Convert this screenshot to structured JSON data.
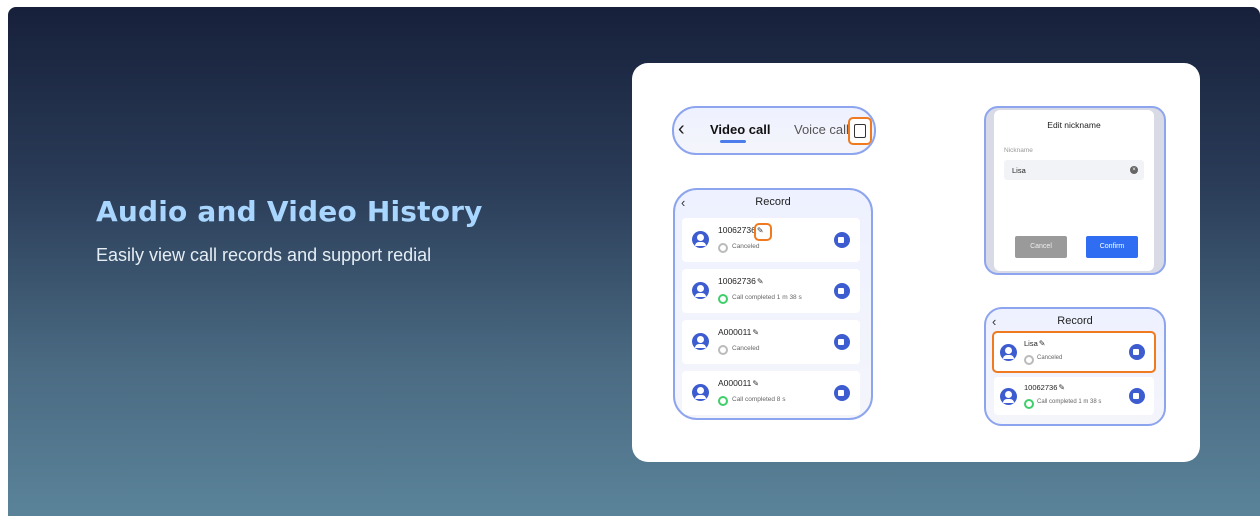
{
  "hero": {
    "title": "Audio and Video History",
    "subtitle": "Easily view call records and support redial"
  },
  "tabbar": {
    "back_icon": "chevron-left",
    "tabs": [
      "Video call",
      "Voice call"
    ],
    "active_tab": "Video call",
    "record_icon": "list-icon"
  },
  "records": {
    "title": "Record",
    "items": [
      {
        "name": "10062736",
        "status": "Canceled",
        "status_color": "#bbbbbb"
      },
      {
        "name": "10062736",
        "status": "Call completed 1 m 38 s",
        "status_color": "#3fcf6a"
      },
      {
        "name": "A000011",
        "status": "Canceled",
        "status_color": "#bbbbbb"
      },
      {
        "name": "A000011",
        "status": "Call completed 8 s",
        "status_color": "#3fcf6a"
      }
    ]
  },
  "edit_dialog": {
    "title": "Edit nickname",
    "label": "Nickname",
    "value": "Lisa",
    "cancel": "Cancel",
    "confirm": "Confirm"
  },
  "records_updated": {
    "title": "Record",
    "items": [
      {
        "name": "Lisa",
        "status": "Canceled"
      },
      {
        "name": "10062736",
        "status": "Call completed 1 m 38 s"
      }
    ]
  },
  "colors": {
    "accent": "#3d5cd0",
    "highlight": "#f07a1f",
    "confirm": "#2f6ef2",
    "title": "#a9d6ff"
  }
}
